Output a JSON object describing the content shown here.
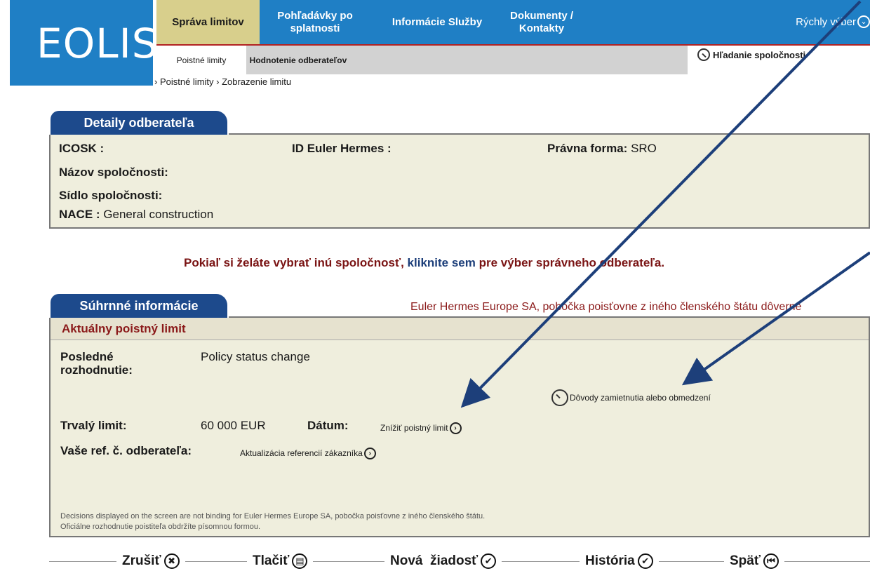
{
  "logo": {
    "text": "EOLIS"
  },
  "nav": {
    "tabs": [
      {
        "label": "Správa limitov"
      },
      {
        "label": "Pohľadávky po splatnosti"
      },
      {
        "label": "Informácie Služby"
      },
      {
        "label": "Dokumenty / Kontakty"
      }
    ],
    "quick_select": "Rýchly výber"
  },
  "subnav": {
    "tabs": [
      {
        "label": "Poistné limity"
      },
      {
        "label": "Hodnotenie odberateľov"
      }
    ],
    "search_label": "Hľadanie spoločnosti"
  },
  "breadcrumb": "› Poistné limity › Zobrazenie limitu",
  "details": {
    "tab_title": "Detaily odberateľa",
    "icosk_label": "ICOSK :",
    "eh_id_label": "ID Euler Hermes :",
    "legal_form_label": "Právna forma:",
    "legal_form_value": "SRO",
    "company_name_label": "Názov spoločnosti:",
    "company_seat_label": "Sídlo spoločnosti:",
    "nace_label": "NACE :",
    "nace_value": "General construction"
  },
  "select_other": {
    "before": "Pokiaľ si želáte vybrať inú spoločnosť,",
    "click": " kliknite sem ",
    "after": "pre výber správneho odberateľa."
  },
  "summary": {
    "tab_title": "Súhrnné informácie",
    "insurer_text": "Euler Hermes Europe SA, pobočka poisťovne z iného členského štátu dôverné",
    "header": "Aktuálny poistný limit",
    "last_decision_label": "Posledné rozhodnutie:",
    "last_decision_value": "Policy status change",
    "reasons_link": "Dôvody zamietnutia alebo obmedzení",
    "permanent_limit_label": "Trvalý limit:",
    "permanent_limit_value": "60 000 EUR",
    "date_label": "Dátum:",
    "reduce_link": "Znížiť poistný limit",
    "ref_label": "Vaše ref. č. odberateľa:",
    "ref_link": "Aktualizácia referencií zákazníka",
    "disclaimer_1": "Decisions displayed on the screen are not binding for Euler Hermes Europe SA, pobočka poisťovne z iného členského štátu.",
    "disclaimer_2": "Oficiálne rozhodnutie poistiteľa obdržíte písomnou formou."
  },
  "buttons": {
    "cancel": "Zrušiť",
    "print": "Tlačiť",
    "new_request": "Nová  žiadosť",
    "history": "História",
    "back": "Späť"
  },
  "colors": {
    "nav_blue": "#1f7fc5",
    "active_tab": "#d8cf8c",
    "panel_tab": "#1d4a8c",
    "panel_bg": "#efeedd",
    "accent_red": "#8b1a1a",
    "arrow": "#1d3f7a"
  }
}
